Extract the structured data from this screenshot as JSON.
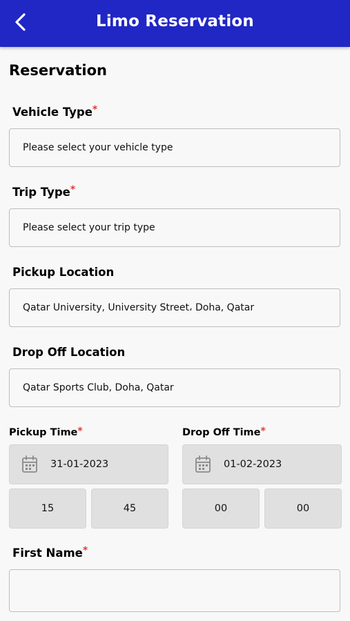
{
  "header": {
    "title": "Limo Reservation",
    "back_icon": "chevron-left-icon",
    "background": "#2127c4"
  },
  "section_title": "Reservation",
  "required_mark": "*",
  "vehicle_type": {
    "label": "Vehicle Type",
    "placeholder": "Please select your vehicle type"
  },
  "trip_type": {
    "label": "Trip Type",
    "placeholder": "Please select your trip type"
  },
  "pickup_location": {
    "label": "Pickup Location",
    "value": "Qatar University, University Street، Doha, Qatar"
  },
  "dropoff_location": {
    "label": "Drop Off Location",
    "value": "Qatar Sports Club, Doha, Qatar"
  },
  "pickup_time": {
    "label": "Pickup Time",
    "date": "31-01-2023",
    "hour": "15",
    "minute": "45",
    "calendar_icon": "calendar-icon"
  },
  "dropoff_time": {
    "label": "Drop Off Time",
    "date": "01-02-2023",
    "hour": "00",
    "minute": "00",
    "calendar_icon": "calendar-icon"
  },
  "first_name": {
    "label": "First Name",
    "value": ""
  }
}
